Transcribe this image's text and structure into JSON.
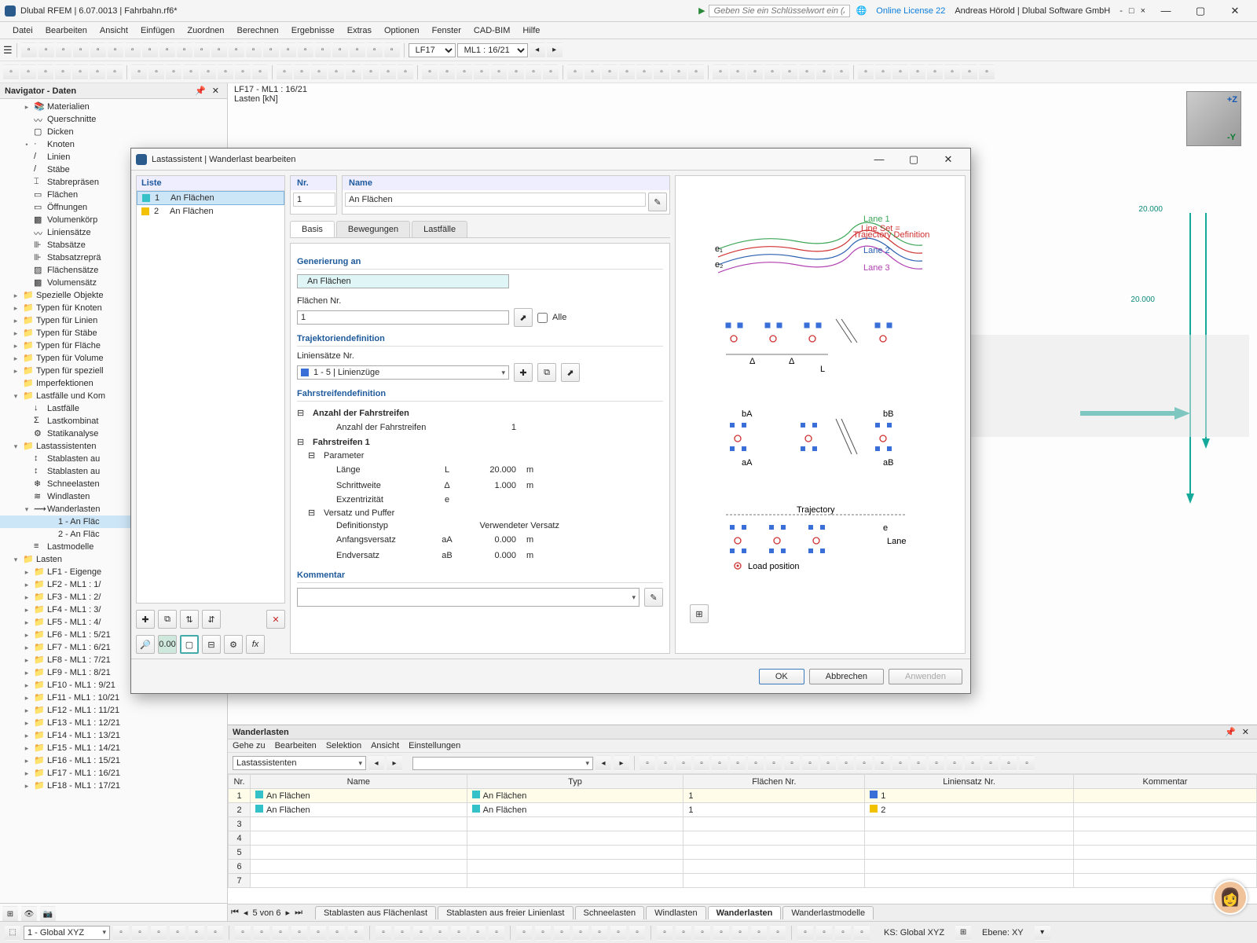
{
  "title": "Dlubal RFEM | 6.07.0013 | Fahrbahn.rf6*",
  "searchPlaceholder": "Geben Sie ein Schlüsselwort ein (Alt...",
  "license": "Online License 22",
  "user": "Andreas Hörold | Dlubal Software GmbH",
  "menu": [
    "Datei",
    "Bearbeiten",
    "Ansicht",
    "Einfügen",
    "Zuordnen",
    "Berechnen",
    "Ergebnisse",
    "Extras",
    "Optionen",
    "Fenster",
    "CAD-BIM",
    "Hilfe"
  ],
  "lfCombo": "LF17",
  "mlCombo": "ML1 : 16/21",
  "navTitle": "Navigator - Daten",
  "tree": [
    {
      "lvl": 2,
      "tw": "▸",
      "ic": "📚",
      "t": "Materialien"
    },
    {
      "lvl": 2,
      "tw": "",
      "ic": "〰",
      "t": "Querschnitte"
    },
    {
      "lvl": 2,
      "tw": "",
      "ic": "▢",
      "t": "Dicken"
    },
    {
      "lvl": 2,
      "tw": "•",
      "ic": "·",
      "t": "Knoten"
    },
    {
      "lvl": 2,
      "tw": "",
      "ic": "/",
      "t": "Linien"
    },
    {
      "lvl": 2,
      "tw": "",
      "ic": "/",
      "t": "Stäbe"
    },
    {
      "lvl": 2,
      "tw": "",
      "ic": "⌶",
      "t": "Stabrepräsen"
    },
    {
      "lvl": 2,
      "tw": "",
      "ic": "▭",
      "t": "Flächen"
    },
    {
      "lvl": 2,
      "tw": "",
      "ic": "▭",
      "t": "Öffnungen"
    },
    {
      "lvl": 2,
      "tw": "",
      "ic": "▩",
      "t": "Volumenkörp"
    },
    {
      "lvl": 2,
      "tw": "",
      "ic": "〰",
      "t": "Liniensätze"
    },
    {
      "lvl": 2,
      "tw": "",
      "ic": "⊪",
      "t": "Stabsätze"
    },
    {
      "lvl": 2,
      "tw": "",
      "ic": "⊪",
      "t": "Stabsatzreprä"
    },
    {
      "lvl": 2,
      "tw": "",
      "ic": "▨",
      "t": "Flächensätze"
    },
    {
      "lvl": 2,
      "tw": "",
      "ic": "▩",
      "t": "Volumensätz"
    },
    {
      "lvl": 1,
      "tw": "▸",
      "ic": "📁",
      "t": "Spezielle Objekte"
    },
    {
      "lvl": 1,
      "tw": "▸",
      "ic": "📁",
      "t": "Typen für Knoten"
    },
    {
      "lvl": 1,
      "tw": "▸",
      "ic": "📁",
      "t": "Typen für Linien"
    },
    {
      "lvl": 1,
      "tw": "▸",
      "ic": "📁",
      "t": "Typen für Stäbe"
    },
    {
      "lvl": 1,
      "tw": "▸",
      "ic": "📁",
      "t": "Typen für Fläche"
    },
    {
      "lvl": 1,
      "tw": "▸",
      "ic": "📁",
      "t": "Typen für Volume"
    },
    {
      "lvl": 1,
      "tw": "▸",
      "ic": "📁",
      "t": "Typen für speziell"
    },
    {
      "lvl": 1,
      "tw": "",
      "ic": "📁",
      "t": "Imperfektionen"
    },
    {
      "lvl": 1,
      "tw": "▾",
      "ic": "📁",
      "t": "Lastfälle und Kom"
    },
    {
      "lvl": 2,
      "tw": "",
      "ic": "↓",
      "t": "Lastfälle"
    },
    {
      "lvl": 2,
      "tw": "",
      "ic": "Σ",
      "t": "Lastkombinat"
    },
    {
      "lvl": 2,
      "tw": "",
      "ic": "⚙",
      "t": "Statikanalyse"
    },
    {
      "lvl": 1,
      "tw": "▾",
      "ic": "📁",
      "t": "Lastassistenten"
    },
    {
      "lvl": 2,
      "tw": "",
      "ic": "↕",
      "t": "Stablasten au"
    },
    {
      "lvl": 2,
      "tw": "",
      "ic": "↕",
      "t": "Stablasten au"
    },
    {
      "lvl": 2,
      "tw": "",
      "ic": "❄",
      "t": "Schneelasten"
    },
    {
      "lvl": 2,
      "tw": "",
      "ic": "≋",
      "t": "Windlasten"
    },
    {
      "lvl": 2,
      "tw": "▾",
      "ic": "⟿",
      "t": "Wanderlasten"
    },
    {
      "lvl": 3,
      "tw": "",
      "ic": "",
      "t": "1 - An Fläc",
      "sel": true
    },
    {
      "lvl": 3,
      "tw": "",
      "ic": "",
      "t": "2 - An Fläc"
    },
    {
      "lvl": 2,
      "tw": "",
      "ic": "≡",
      "t": "Lastmodelle"
    },
    {
      "lvl": 1,
      "tw": "▾",
      "ic": "📁",
      "t": "Lasten"
    },
    {
      "lvl": 2,
      "tw": "▸",
      "ic": "📁",
      "t": "LF1 - Eigenge"
    },
    {
      "lvl": 2,
      "tw": "▸",
      "ic": "📁",
      "t": "LF2 - ML1 : 1/"
    },
    {
      "lvl": 2,
      "tw": "▸",
      "ic": "📁",
      "t": "LF3 - ML1 : 2/"
    },
    {
      "lvl": 2,
      "tw": "▸",
      "ic": "📁",
      "t": "LF4 - ML1 : 3/"
    },
    {
      "lvl": 2,
      "tw": "▸",
      "ic": "📁",
      "t": "LF5 - ML1 : 4/"
    },
    {
      "lvl": 2,
      "tw": "▸",
      "ic": "📁",
      "t": "LF6 - ML1 : 5/21"
    },
    {
      "lvl": 2,
      "tw": "▸",
      "ic": "📁",
      "t": "LF7 - ML1 : 6/21"
    },
    {
      "lvl": 2,
      "tw": "▸",
      "ic": "📁",
      "t": "LF8 - ML1 : 7/21"
    },
    {
      "lvl": 2,
      "tw": "▸",
      "ic": "📁",
      "t": "LF9 - ML1 : 8/21"
    },
    {
      "lvl": 2,
      "tw": "▸",
      "ic": "📁",
      "t": "LF10 - ML1 : 9/21"
    },
    {
      "lvl": 2,
      "tw": "▸",
      "ic": "📁",
      "t": "LF11 - ML1 : 10/21"
    },
    {
      "lvl": 2,
      "tw": "▸",
      "ic": "📁",
      "t": "LF12 - ML1 : 11/21"
    },
    {
      "lvl": 2,
      "tw": "▸",
      "ic": "📁",
      "t": "LF13 - ML1 : 12/21"
    },
    {
      "lvl": 2,
      "tw": "▸",
      "ic": "📁",
      "t": "LF14 - ML1 : 13/21"
    },
    {
      "lvl": 2,
      "tw": "▸",
      "ic": "📁",
      "t": "LF15 - ML1 : 14/21"
    },
    {
      "lvl": 2,
      "tw": "▸",
      "ic": "📁",
      "t": "LF16 - ML1 : 15/21"
    },
    {
      "lvl": 2,
      "tw": "▸",
      "ic": "📁",
      "t": "LF17 - ML1 : 16/21"
    },
    {
      "lvl": 2,
      "tw": "▸",
      "ic": "📁",
      "t": "LF18 - ML1 : 17/21"
    }
  ],
  "viewTitle": "LF17 - ML1 : 16/21",
  "viewSub": "Lasten [kN]",
  "dim1": "20.000",
  "dim2": "20.000",
  "dlg": {
    "title": "Lastassistent | Wanderlast bearbeiten",
    "listHeader": "Liste",
    "list": [
      {
        "n": "1",
        "t": "An Flächen",
        "c": "#35c1c8",
        "sel": true
      },
      {
        "n": "2",
        "t": "An Flächen",
        "c": "#f2c200"
      }
    ],
    "nrHdr": "Nr.",
    "nr": "1",
    "nameHdr": "Name",
    "name": "An Flächen",
    "tabs": [
      "Basis",
      "Bewegungen",
      "Lastfälle"
    ],
    "sectGen": "Generierung an",
    "genType": "An Flächen",
    "flNrLbl": "Flächen Nr.",
    "flNr": "1",
    "alle": "Alle",
    "sectTraj": "Trajektoriendefinition",
    "lsLbl": "Liniensätze Nr.",
    "lsVal": "1 - 5 | Linienzüge",
    "sectFs": "Fahrstreifendefinition",
    "rows": [
      {
        "grp": "Anzahl der Fahrstreifen"
      },
      {
        "lab": "Anzahl der Fahrstreifen",
        "val": "1"
      },
      {
        "grp": "Fahrstreifen 1"
      },
      {
        "sub": "Parameter"
      },
      {
        "lab": "Länge",
        "sym": "L",
        "val": "20.000",
        "unit": "m"
      },
      {
        "lab": "Schrittweite",
        "sym": "Δ",
        "val": "1.000",
        "unit": "m"
      },
      {
        "lab": "Exzentrizität",
        "sym": "e",
        "val": "",
        "unit": ""
      },
      {
        "sub": "Versatz und Puffer"
      },
      {
        "lab": "Definitionstyp",
        "valtxt": "Verwendeter Versatz"
      },
      {
        "lab": "Anfangsversatz",
        "sym": "aA",
        "val": "0.000",
        "unit": "m"
      },
      {
        "lab": "Endversatz",
        "sym": "aB",
        "val": "0.000",
        "unit": "m"
      }
    ],
    "sectKom": "Kommentar",
    "ok": "OK",
    "cancel": "Abbrechen",
    "apply": "Anwenden",
    "imgLbls": {
      "l1": "Lane 1",
      "ls": "Line Set =",
      "td": "Trajectory Definition",
      "l2": "Lane 2",
      "l3": "Lane 3",
      "traj": "Trajectory",
      "lane": "Lane",
      "lp": "Load position"
    }
  },
  "bpanel": {
    "title": "Wanderlasten",
    "menu": [
      "Gehe zu",
      "Bearbeiten",
      "Selektion",
      "Ansicht",
      "Einstellungen"
    ],
    "combo": "Lastassistenten",
    "cols": [
      "Nr.",
      "Name",
      "Typ",
      "Flächen Nr.",
      "Liniensatz Nr.",
      "Kommentar"
    ],
    "rows": [
      {
        "n": "1",
        "name": "An Flächen",
        "typ": "An Flächen",
        "fl": "1",
        "ls": "1",
        "c": "#35c1c8",
        "lc": "#3a6fd8",
        "sel": true
      },
      {
        "n": "2",
        "name": "An Flächen",
        "typ": "An Flächen",
        "fl": "1",
        "ls": "2",
        "c": "#35c1c8",
        "lc": "#f2c200"
      }
    ],
    "pager": "5 von 6",
    "tabs": [
      "Stablasten aus Flächenlast",
      "Stablasten aus freier Linienlast",
      "Schneelasten",
      "Windlasten",
      "Wanderlasten",
      "Wanderlastmodelle"
    ],
    "activeTab": 4
  },
  "status": {
    "cs": "1 - Global XYZ",
    "ks": "KS: Global XYZ",
    "ebene": "Ebene: XY"
  }
}
